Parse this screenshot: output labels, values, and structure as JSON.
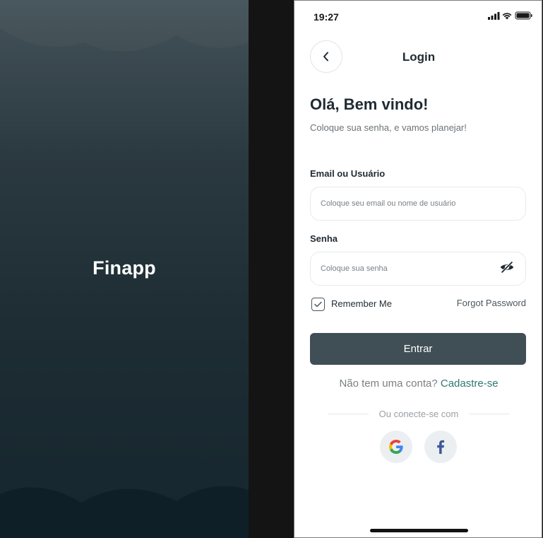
{
  "splash": {
    "app_name": "Finapp"
  },
  "status_bar": {
    "time": "19:27"
  },
  "header": {
    "title": "Login"
  },
  "welcome": {
    "title": "Olá, Bem vindo!",
    "subtitle": "Coloque sua senha, e vamos planejar!"
  },
  "form": {
    "email_label": "Email ou Usuário",
    "email_placeholder": "Coloque seu email ou nome de usuário",
    "password_label": "Senha",
    "password_placeholder": "Coloque sua senha",
    "remember_label": "Remember Me",
    "remember_checked": true,
    "forgot_label": "Forgot Password",
    "submit_label": "Entrar"
  },
  "signup": {
    "prompt": "Não tem uma conta?",
    "link": "Cadastre-se"
  },
  "social": {
    "divider_text": "Ou conecte-se com",
    "providers": [
      "google-icon",
      "facebook-icon"
    ]
  },
  "colors": {
    "primary_button": "#404e55",
    "link": "#2f7a6e",
    "splash_top": "#445359",
    "splash_bottom": "#16262e"
  }
}
